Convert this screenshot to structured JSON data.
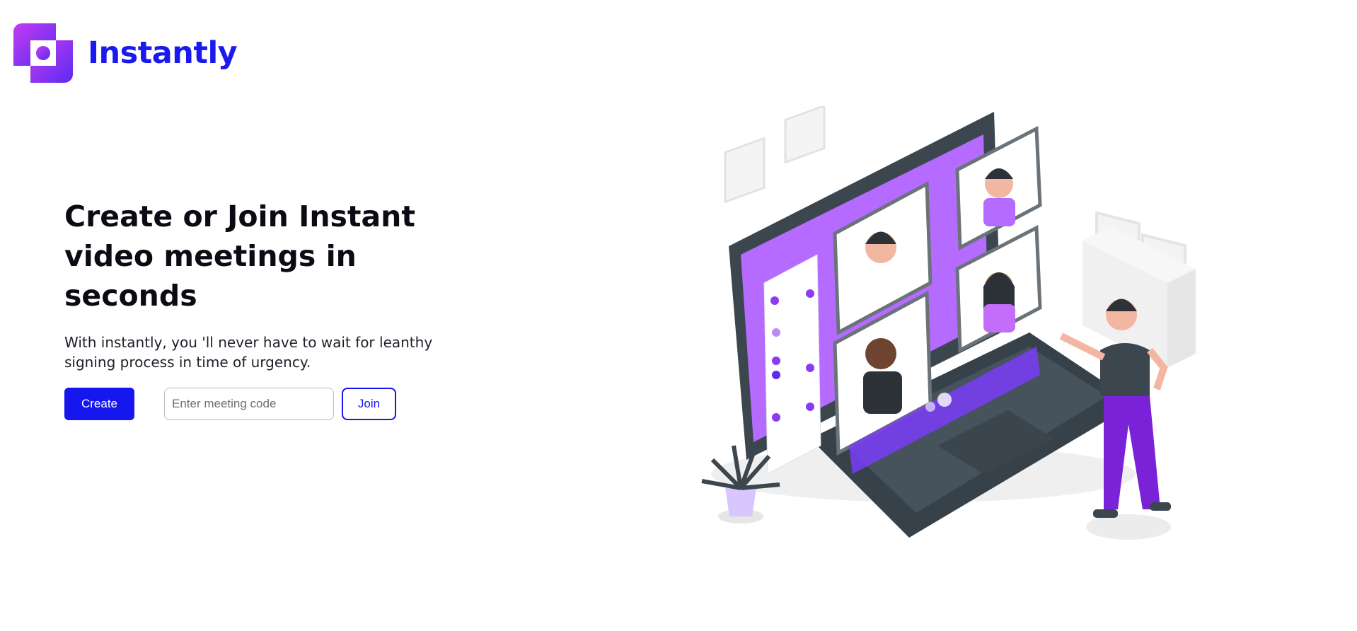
{
  "brand": {
    "name": "Instantly",
    "logo_icon": "square-frame-logo-icon",
    "color": "#1a1aee"
  },
  "hero": {
    "headline_line1": "Create or Join Instant",
    "headline_line2": "video meetings in seconds",
    "subtext": "With instantly, you 'll never have to wait for leanthy signing process in time of urgency."
  },
  "actions": {
    "create_label": "Create",
    "code_placeholder": "Enter meeting code",
    "join_label": "Join"
  },
  "illustration": {
    "icon": "video-conference-illustration"
  },
  "colors": {
    "accent": "#1616ee",
    "purple": "#b56bff"
  }
}
